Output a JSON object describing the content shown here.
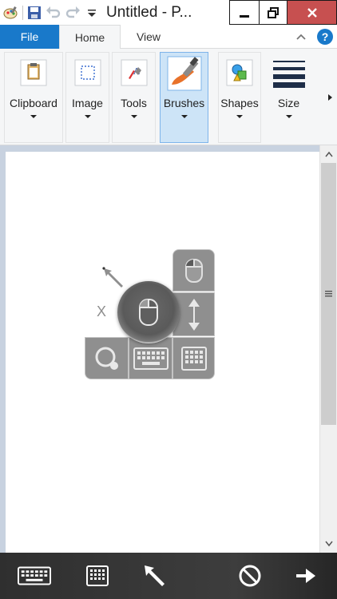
{
  "window": {
    "title": "Untitled - P..."
  },
  "tabs": {
    "file": "File",
    "home": "Home",
    "view": "View"
  },
  "ribbon": {
    "groups": [
      {
        "label": "Clipboard",
        "icon": "clipboard-icon"
      },
      {
        "label": "Image",
        "icon": "select-icon"
      },
      {
        "label": "Tools",
        "icon": "tools-icon"
      },
      {
        "label": "Brushes",
        "icon": "brush-icon",
        "selected": true
      },
      {
        "label": "Shapes",
        "icon": "shapes-icon"
      },
      {
        "label": "Size",
        "icon": "size-icon"
      }
    ]
  },
  "touch_widget": {
    "close_label": "X"
  },
  "colors": {
    "file_tab": "#1979ca",
    "close_button": "#c75050",
    "ribbon_bg": "#f5f6f7",
    "selected_group": "#cde4f7",
    "workspace_bg": "#c8d2e0",
    "widget_gray": "#8f8f8f"
  },
  "bottom_toolbar": {
    "items": [
      "keyboard-icon",
      "keypad-icon",
      "pointer-arrow-icon",
      "no-entry-icon",
      "right-arrow-icon"
    ]
  }
}
